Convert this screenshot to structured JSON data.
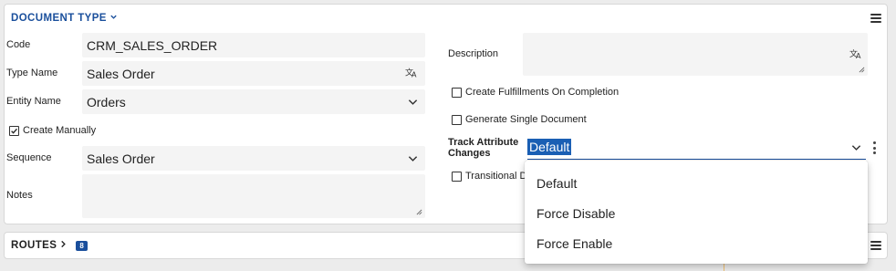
{
  "document_type": {
    "title": "DOCUMENT TYPE",
    "fields": {
      "code": {
        "label": "Code",
        "value": "CRM_SALES_ORDER"
      },
      "type_name": {
        "label": "Type Name",
        "value": "Sales Order"
      },
      "entity_name": {
        "label": "Entity Name",
        "value": "Orders"
      },
      "create_manually": {
        "label": "Create Manually",
        "checked": true
      },
      "sequence": {
        "label": "Sequence",
        "value": "Sales Order"
      },
      "notes": {
        "label": "Notes",
        "value": ""
      },
      "description": {
        "label": "Description",
        "value": ""
      },
      "create_fulfillments": {
        "label": "Create Fulfillments On Completion",
        "checked": false
      },
      "generate_single": {
        "label": "Generate Single Document",
        "checked": false
      },
      "track_attribute": {
        "label_line1": "Track Attribute",
        "label_line2": "Changes",
        "value": "Default"
      },
      "transitional": {
        "label": "Transitional D",
        "checked": false
      }
    },
    "dropdown_options": [
      "Default",
      "Force Disable",
      "Force Enable"
    ]
  },
  "routes": {
    "title": "ROUTES",
    "count": "8"
  },
  "colors": {
    "accent": "#1a4f9c",
    "selection": "#1a5fb4"
  }
}
